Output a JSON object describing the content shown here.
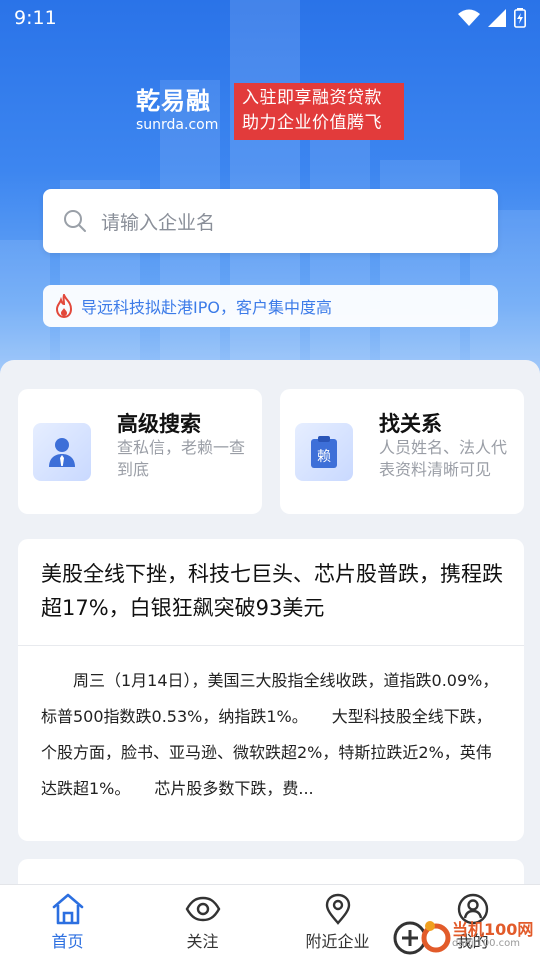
{
  "status_bar": {
    "time": "9:11"
  },
  "brand": {
    "name": "乾易融",
    "domain": "sunrda.com",
    "slogan_line1": "入驻即享融资贷款",
    "slogan_line2": "助力企业价值腾飞"
  },
  "search": {
    "placeholder": "请输入企业名"
  },
  "ticker": {
    "text": "导远科技拟赴港IPO，客户集中度高"
  },
  "features": [
    {
      "title": "高级搜索",
      "desc": "查私信，老赖一查到底",
      "icon": "person-tie-icon"
    },
    {
      "title": "找关系",
      "desc": "人员姓名、法人代表资料清晰可见",
      "icon": "clipboard-lai-icon",
      "icon_char": "赖"
    }
  ],
  "news": {
    "headline": "美股全线下挫，科技七巨头、芯片股普跌，携程跌超17%，白银狂飙突破93美元",
    "body": "　　周三（1月14日），美国三大股指全线收跌，道指跌0.09%，标普500指数跌0.53%，纳指跌1%。　　大型科技股全线下跌，个股方面，脸书、亚马逊、微软跌超2%，特斯拉跌近2%，英伟达跌超1%。　　芯片股多数下跌，费..."
  },
  "tabs": [
    {
      "label": "首页",
      "icon": "home-icon",
      "active": true
    },
    {
      "label": "关注",
      "icon": "eye-icon",
      "active": false
    },
    {
      "label": "附近企业",
      "icon": "location-pin-icon",
      "active": false
    },
    {
      "label": "我的",
      "icon": "user-icon",
      "active": false
    }
  ],
  "watermark": {
    "text": "当机100网",
    "sub": "danji100.com"
  },
  "colors": {
    "primary": "#2c6fe0",
    "slogan_bg": "#e23b3b",
    "ticker_text": "#3c7be8"
  }
}
